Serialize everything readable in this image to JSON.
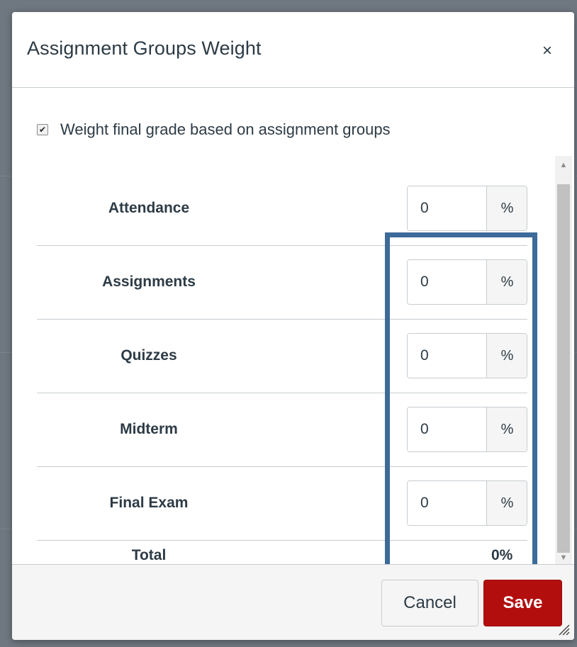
{
  "dialog": {
    "title": "Assignment Groups Weight",
    "close_glyph": "×"
  },
  "weight_toggle": {
    "label": "Weight final grade based on assignment groups",
    "checked": true,
    "check_glyph": "✔"
  },
  "groups": [
    {
      "name": "Attendance",
      "value": "0",
      "unit": "%"
    },
    {
      "name": "Assignments",
      "value": "0",
      "unit": "%"
    },
    {
      "name": "Quizzes",
      "value": "0",
      "unit": "%"
    },
    {
      "name": "Midterm",
      "value": "0",
      "unit": "%"
    },
    {
      "name": "Final Exam",
      "value": "0",
      "unit": "%"
    }
  ],
  "total": {
    "label": "Total",
    "value": "0%"
  },
  "scrollbar": {
    "up_glyph": "▲",
    "down_glyph": "▼"
  },
  "footer": {
    "cancel_label": "Cancel",
    "save_label": "Save"
  },
  "colors": {
    "highlight_border": "#3c6a99",
    "save_button": "#b30e0e",
    "text": "#2d3b45"
  },
  "icons": [
    "close-icon",
    "checkmark-icon",
    "scroll-up-icon",
    "scroll-down-icon",
    "resize-grip-icon"
  ]
}
